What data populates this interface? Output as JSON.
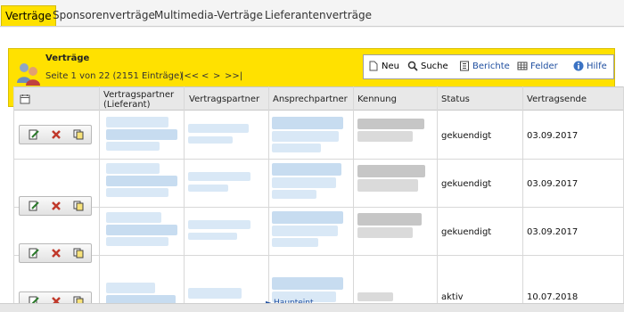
{
  "tabs": [
    {
      "label": "Verträge",
      "active": true
    },
    {
      "label": "Sponsorenverträge",
      "active": false
    },
    {
      "label": "Multimedia-Verträge",
      "active": false
    },
    {
      "label": "Lieferantenverträge",
      "active": false
    }
  ],
  "header": {
    "title": "Verträge",
    "page_info": "Seite 1 von 22 (2151 Einträge)",
    "nav_first": "|<<",
    "nav_prev": "<",
    "nav_next": ">",
    "nav_last": ">>|"
  },
  "toolbar": {
    "new": "Neu",
    "search": "Suche",
    "reports": "Berichte",
    "fields": "Felder",
    "help": "Hilfe"
  },
  "table": {
    "columns": [
      "Vertragspartner (Lieferant)",
      "Vertragspartner",
      "Ansprechpartner",
      "Kennung",
      "Status",
      "Vertragsende"
    ],
    "rows": [
      {
        "status": "gekuendigt",
        "end": "03.09.2017"
      },
      {
        "status": "gekuendigt",
        "end": "03.09.2017"
      },
      {
        "status": "gekuendigt",
        "end": "03.09.2017"
      },
      {
        "status": "aktiv",
        "end": "10.07.2018"
      }
    ]
  },
  "footer_link": "Haupteint",
  "colors": {
    "accent": "#ffe100",
    "link": "#1f4fa0"
  }
}
